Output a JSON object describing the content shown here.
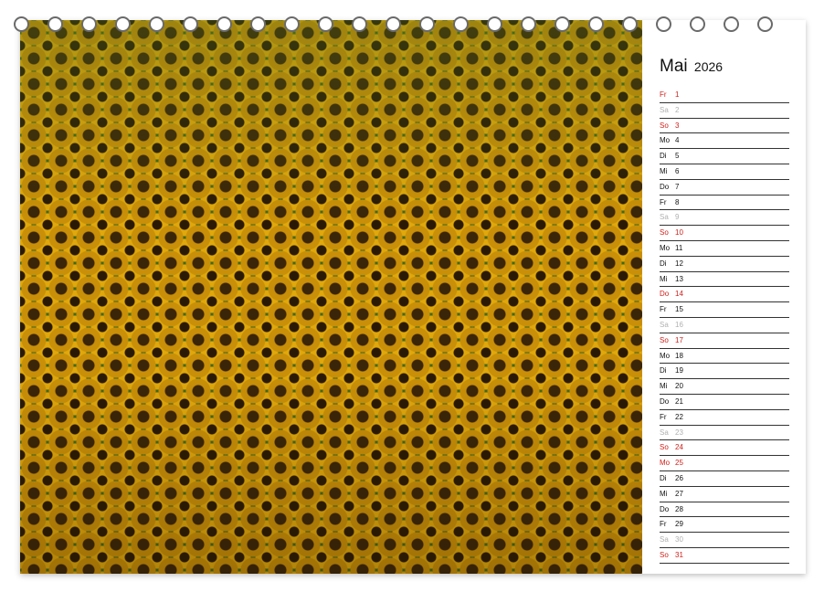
{
  "calendar": {
    "month": "Mai",
    "year": "2026",
    "days": [
      {
        "name": "Fr",
        "num": "1",
        "type": "hol"
      },
      {
        "name": "Sa",
        "num": "2",
        "type": "sat"
      },
      {
        "name": "So",
        "num": "3",
        "type": "sun"
      },
      {
        "name": "Mo",
        "num": "4",
        "type": "normal"
      },
      {
        "name": "Di",
        "num": "5",
        "type": "normal"
      },
      {
        "name": "Mi",
        "num": "6",
        "type": "normal"
      },
      {
        "name": "Do",
        "num": "7",
        "type": "normal"
      },
      {
        "name": "Fr",
        "num": "8",
        "type": "normal"
      },
      {
        "name": "Sa",
        "num": "9",
        "type": "sat"
      },
      {
        "name": "So",
        "num": "10",
        "type": "sun"
      },
      {
        "name": "Mo",
        "num": "11",
        "type": "normal"
      },
      {
        "name": "Di",
        "num": "12",
        "type": "normal"
      },
      {
        "name": "Mi",
        "num": "13",
        "type": "normal"
      },
      {
        "name": "Do",
        "num": "14",
        "type": "hol"
      },
      {
        "name": "Fr",
        "num": "15",
        "type": "normal"
      },
      {
        "name": "Sa",
        "num": "16",
        "type": "sat"
      },
      {
        "name": "So",
        "num": "17",
        "type": "sun"
      },
      {
        "name": "Mo",
        "num": "18",
        "type": "normal"
      },
      {
        "name": "Di",
        "num": "19",
        "type": "normal"
      },
      {
        "name": "Mi",
        "num": "20",
        "type": "normal"
      },
      {
        "name": "Do",
        "num": "21",
        "type": "normal"
      },
      {
        "name": "Fr",
        "num": "22",
        "type": "normal"
      },
      {
        "name": "Sa",
        "num": "23",
        "type": "sat"
      },
      {
        "name": "So",
        "num": "24",
        "type": "sun"
      },
      {
        "name": "Mo",
        "num": "25",
        "type": "hol"
      },
      {
        "name": "Di",
        "num": "26",
        "type": "normal"
      },
      {
        "name": "Mi",
        "num": "27",
        "type": "normal"
      },
      {
        "name": "Do",
        "num": "28",
        "type": "normal"
      },
      {
        "name": "Fr",
        "num": "29",
        "type": "normal"
      },
      {
        "name": "Sa",
        "num": "30",
        "type": "sat"
      },
      {
        "name": "So",
        "num": "31",
        "type": "sun"
      }
    ]
  },
  "colors": {
    "sunday_holiday": "#d0201a",
    "saturday": "#b0b0b0",
    "weekday": "#111111"
  },
  "ring_count": 23
}
